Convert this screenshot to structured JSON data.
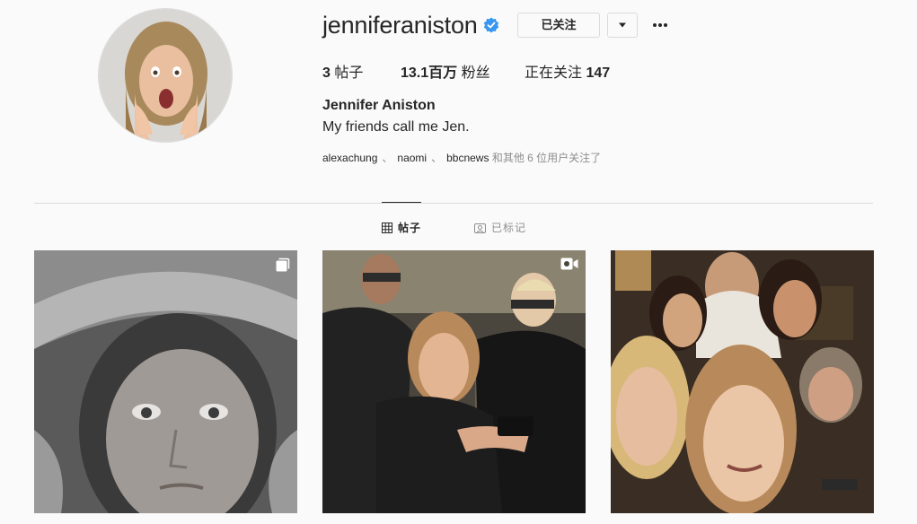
{
  "profile": {
    "username": "jenniferaniston",
    "verified": true,
    "follow_label": "已关注",
    "full_name": "Jennifer Aniston",
    "bio": "My friends call me Jen."
  },
  "stats": {
    "posts_count": "3",
    "posts_label": "帖子",
    "followers_count": "13.1百万",
    "followers_label": "粉丝",
    "following_label": "正在关注",
    "following_count": "147"
  },
  "followed_by": {
    "users": [
      "alexachung",
      "naomi",
      "bbcnews"
    ],
    "separator": "、",
    "rest": "和其他 6 位用户关注了"
  },
  "tabs": [
    {
      "label": "帖子",
      "icon": "grid-icon",
      "active": true
    },
    {
      "label": "已标记",
      "icon": "tag-icon",
      "active": false
    }
  ],
  "posts": [
    {
      "type": "carousel",
      "badge_icon": "carousel-icon"
    },
    {
      "type": "video",
      "badge_icon": "video-icon"
    },
    {
      "type": "photo"
    }
  ],
  "colors": {
    "verified_blue": "#3897f0",
    "text": "#262626",
    "muted": "#8e8e8e",
    "border": "#dbdbdb",
    "background": "#fafafa"
  }
}
